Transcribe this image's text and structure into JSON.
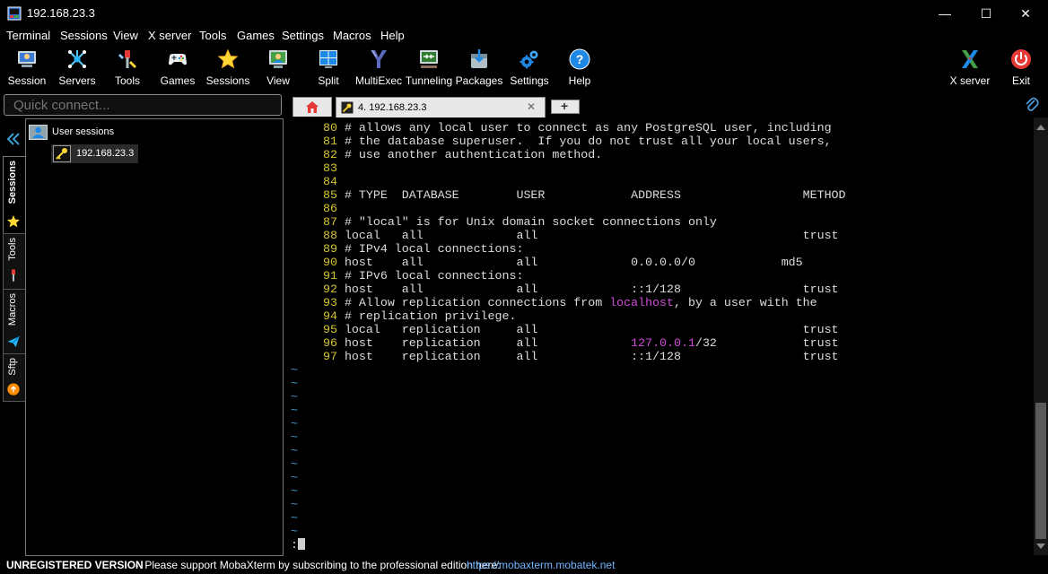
{
  "window": {
    "title": "192.168.23.3",
    "minimize_label": "—",
    "maximize_label": "☐",
    "close_label": "✕"
  },
  "menu": [
    "Terminal",
    "Sessions",
    "View",
    "X server",
    "Tools",
    "Games",
    "Settings",
    "Macros",
    "Help"
  ],
  "toolbar": {
    "buttons": [
      {
        "label": "Session",
        "icon": "session-icon"
      },
      {
        "label": "Servers",
        "icon": "servers-icon"
      },
      {
        "label": "Tools",
        "icon": "tools-icon"
      },
      {
        "label": "Games",
        "icon": "gamepad-icon"
      },
      {
        "label": "Sessions",
        "icon": "star-icon"
      },
      {
        "label": "View",
        "icon": "view-icon"
      },
      {
        "label": "Split",
        "icon": "split-icon"
      },
      {
        "label": "MultiExec",
        "icon": "multiexec-icon"
      },
      {
        "label": "Tunneling",
        "icon": "tunneling-icon"
      },
      {
        "label": "Packages",
        "icon": "packages-icon"
      },
      {
        "label": "Settings",
        "icon": "gears-icon"
      },
      {
        "label": "Help",
        "icon": "help-icon"
      }
    ],
    "right_buttons": [
      {
        "label": "X server",
        "icon": "xserver-icon"
      },
      {
        "label": "Exit",
        "icon": "power-icon"
      }
    ]
  },
  "quick_connect": {
    "placeholder": "Quick connect..."
  },
  "side_tabs": [
    {
      "label": "Sessions",
      "icon": "star-icon"
    },
    {
      "label": "Tools",
      "icon": "tools-icon"
    },
    {
      "label": "Macros",
      "icon": "paper-plane-icon"
    },
    {
      "label": "Sftp",
      "icon": "sftp-icon"
    }
  ],
  "sessions_panel": {
    "root_label": "User sessions",
    "items": [
      {
        "label": "192.168.23.3",
        "icon": "key-icon"
      }
    ]
  },
  "tabs": {
    "home_icon": "home-icon",
    "active_tab": {
      "label": "4. 192.168.23.3",
      "icon": "key-icon"
    },
    "close_label": "✕",
    "new_tab_label": "+",
    "attach_icon": "paperclip-icon"
  },
  "terminal": {
    "lines": [
      {
        "n": "80",
        "parts": [
          {
            "t": "# allows any local user to connect as any PostgreSQL user, including"
          }
        ]
      },
      {
        "n": "81",
        "parts": [
          {
            "t": "# the database superuser.  If you do not trust all your local users,"
          }
        ]
      },
      {
        "n": "82",
        "parts": [
          {
            "t": "# use another authentication method."
          }
        ]
      },
      {
        "n": "83",
        "parts": []
      },
      {
        "n": "84",
        "parts": []
      },
      {
        "n": "85",
        "parts": [
          {
            "t": "# TYPE  DATABASE        USER            ADDRESS                 METHOD"
          }
        ]
      },
      {
        "n": "86",
        "parts": []
      },
      {
        "n": "87",
        "parts": [
          {
            "t": "# \"local\" is for Unix domain socket connections only"
          }
        ]
      },
      {
        "n": "88",
        "parts": [
          {
            "t": "local   all             all                                     trust"
          }
        ]
      },
      {
        "n": "89",
        "parts": [
          {
            "t": "# IPv4 local connections:"
          }
        ]
      },
      {
        "n": "90",
        "parts": [
          {
            "t": "host    all             all             0.0.0.0/0            md5"
          }
        ]
      },
      {
        "n": "91",
        "parts": [
          {
            "t": "# IPv6 local connections:"
          }
        ]
      },
      {
        "n": "92",
        "parts": [
          {
            "t": "host    all             all             ::1/128                 trust"
          }
        ]
      },
      {
        "n": "93",
        "parts": [
          {
            "t": "# Allow replication connections from "
          },
          {
            "t": "localhost",
            "c": "magenta"
          },
          {
            "t": ", by a user with the"
          }
        ]
      },
      {
        "n": "94",
        "parts": [
          {
            "t": "# replication privilege."
          }
        ]
      },
      {
        "n": "95",
        "parts": [
          {
            "t": "local   replication     all                                     trust"
          }
        ]
      },
      {
        "n": "96",
        "parts": [
          {
            "t": "host    replication     all             "
          },
          {
            "t": "127.0.0.1",
            "c": "magenta"
          },
          {
            "t": "/32            trust"
          }
        ]
      },
      {
        "n": "97",
        "parts": [
          {
            "t": "host    replication     all             ::1/128                 trust"
          }
        ]
      }
    ],
    "empty_line_marker": "~",
    "empty_line_count": 13,
    "command_prompt": ":"
  },
  "status_bar": {
    "label": "UNREGISTERED VERSION",
    "message": "  -  Please support MobaXterm by subscribing to the professional edition here:  ",
    "link": "https://mobaxterm.mobatek.net"
  },
  "colors": {
    "line_number": "#d6c532",
    "tilde": "#3e9fd0",
    "highlight": "#d04bd8",
    "text": "#dcdcdc",
    "link": "#6fb4ff"
  }
}
